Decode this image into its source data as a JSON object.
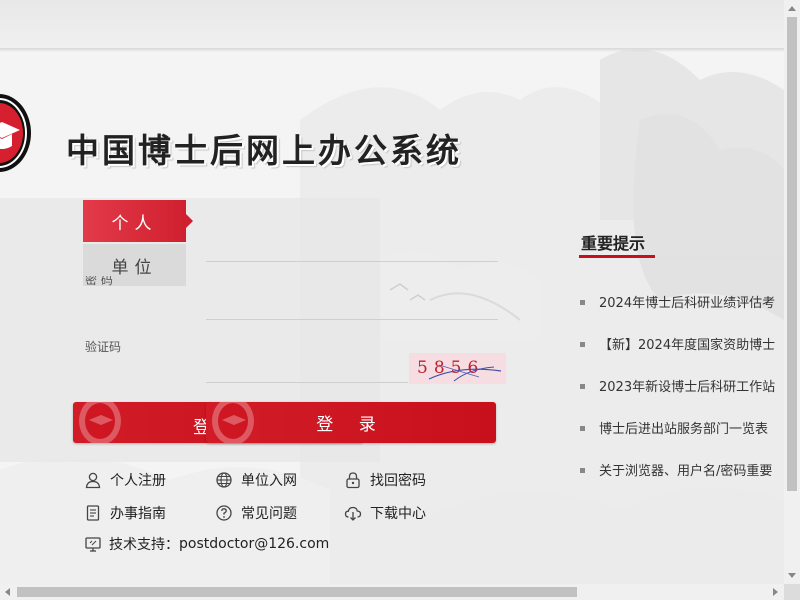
{
  "header": {
    "title": "中国博士后网上办公系统"
  },
  "login": {
    "tabs": [
      {
        "label": "个人"
      },
      {
        "label": "单位"
      }
    ],
    "password_label": "密 码",
    "code_label": "验证码",
    "captcha_text": "5856",
    "submit_label": "登 录",
    "submit_label_behind": "登"
  },
  "links": [
    {
      "label": "个人注册",
      "icon": "user-icon"
    },
    {
      "label": "单位入网",
      "icon": "globe-icon"
    },
    {
      "label": "找回密码",
      "icon": "lock-icon"
    },
    {
      "label": "办事指南",
      "icon": "document-icon"
    },
    {
      "label": "常见问题",
      "icon": "question-icon"
    },
    {
      "label": "下载中心",
      "icon": "cloud-download-icon"
    }
  ],
  "support": {
    "label": "技术支持：",
    "email": "postdoctor@126.com",
    "icon": "monitor-icon"
  },
  "notices": {
    "title": "重要提示",
    "items": [
      "2024年博士后科研业绩评估考",
      "【新】2024年度国家资助博士",
      "2023年新设博士后科研工作站",
      "博士后进出站服务部门一览表",
      "关于浏览器、用户名/密码重要"
    ]
  },
  "colors": {
    "brand_red": "#c8101c",
    "tab_red": "#e23a49",
    "tab_gray": "#dadada"
  }
}
